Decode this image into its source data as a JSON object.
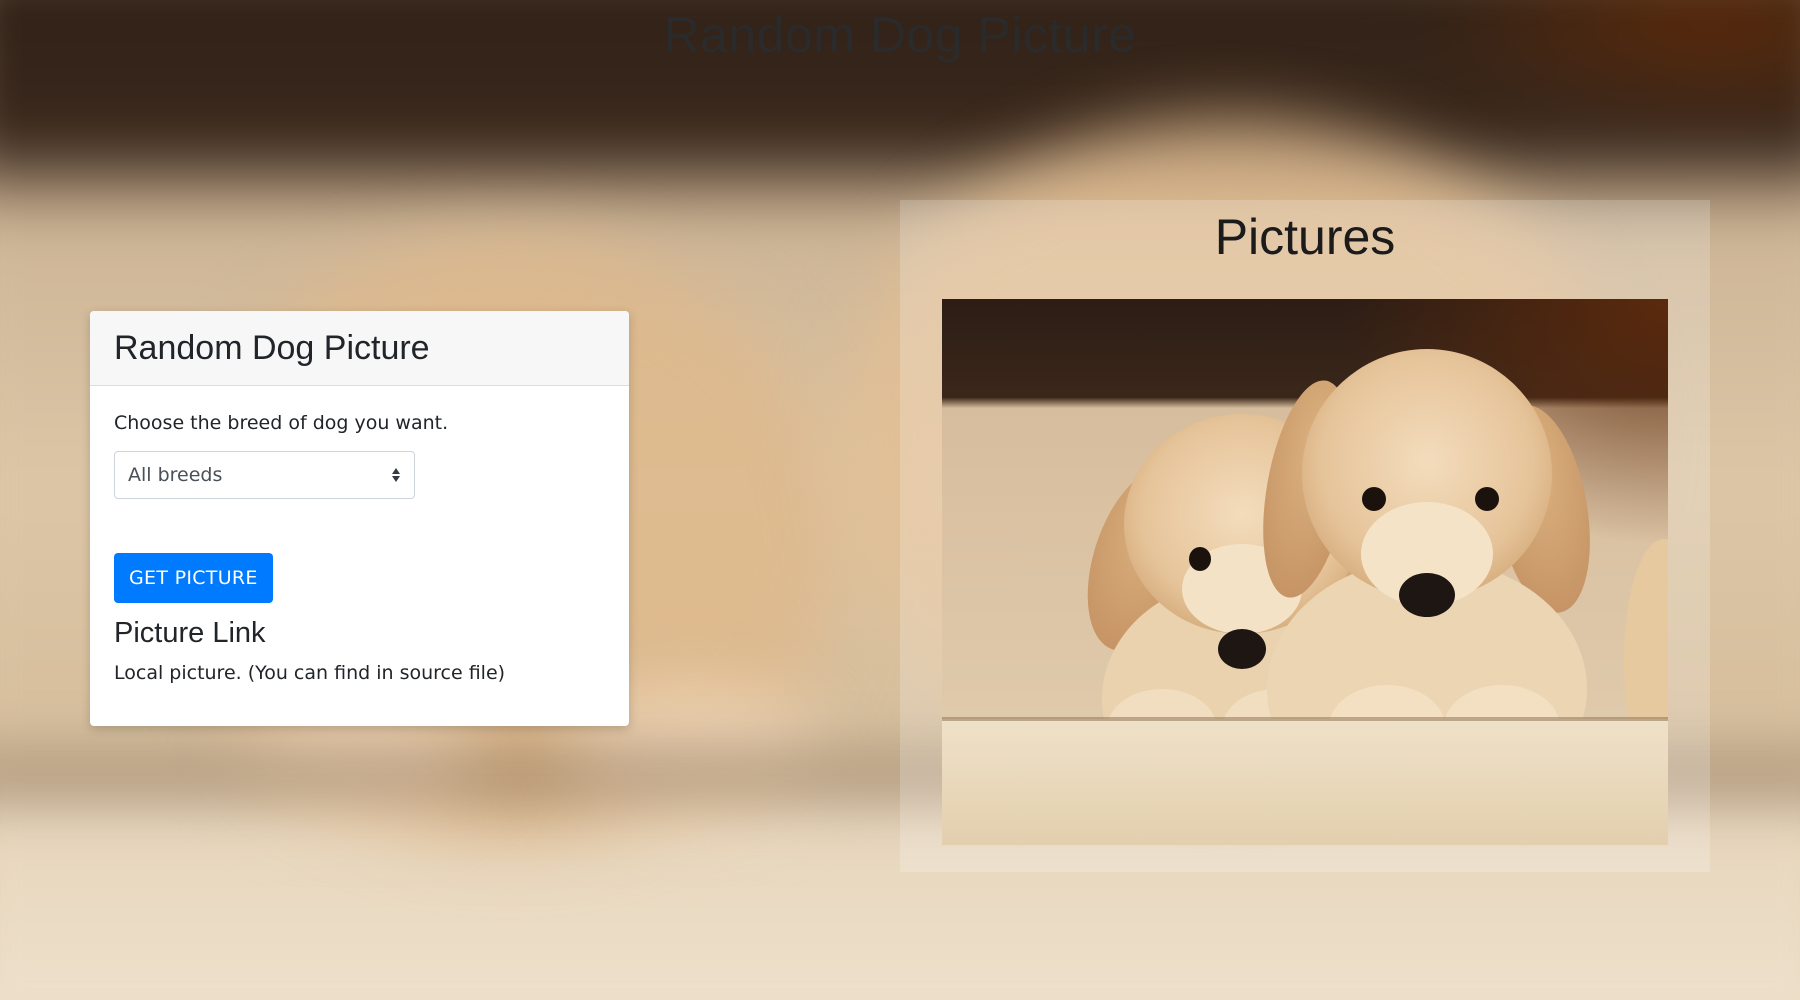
{
  "page": {
    "title": "Random Dog Picture"
  },
  "card": {
    "title": "Random Dog Picture",
    "prompt": "Choose the breed of dog you want.",
    "breed_select": {
      "value": "All breeds"
    },
    "button_label": "GET PICTURE",
    "link_heading": "Picture Link",
    "link_text": "Local picture. (You can find in source file)"
  },
  "pictures": {
    "title": "Pictures",
    "image_subject": "two golden retriever puppies"
  },
  "colors": {
    "button": "#007bff",
    "card_header": "#f7f7f7"
  }
}
